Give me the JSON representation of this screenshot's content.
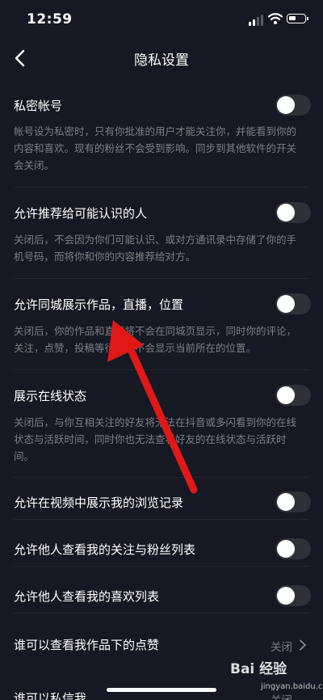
{
  "status_bar": {
    "time": "12:59"
  },
  "nav": {
    "title": "隐私设置"
  },
  "settings": [
    {
      "title": "私密帐号",
      "desc": "帐号设为私密时，只有你批准的用户才能关注你，并能看到你的内容和喜欢。现有的粉丝不会受到影响。同步到其他软件的开关会关闭。",
      "enabled": false
    },
    {
      "title": "允许推荐给可能认识的人",
      "desc": "关闭后，不会因为你们可能认识、或对方通讯录中存储了你的手机号码，而将你和你的内容推荐给对方。",
      "enabled": false
    },
    {
      "title": "允许同城展示作品，直播，位置",
      "desc": "关闭后，你的作品和直播将不会在同城页显示，同时你的评论，关注，点赞，投稿等行为也不会显示当前所在的位置。",
      "enabled": false
    },
    {
      "title": "展示在线状态",
      "desc": "关闭后，与你互相关注的好友将无法在抖音或多闪看到你的在线状态与活跃时间，同时你也无法查看好友的在线状态与活跃时间。",
      "enabled": false
    },
    {
      "title": "允许在视频中展示我的浏览记录",
      "enabled": false
    },
    {
      "title": "允许他人查看我的关注与粉丝列表",
      "enabled": false
    },
    {
      "title": "允许他人查看我的喜欢列表",
      "enabled": false
    },
    {
      "title": "谁可以查看我作品下的点赞",
      "value": "关闭"
    },
    {
      "title": "谁可以私信我",
      "value": "关闭"
    }
  ],
  "watermark": {
    "brand": "Bai 经验",
    "url": "jingyan.baidu.com"
  },
  "colors": {
    "background": "#161823",
    "annotation_arrow": "#e01818",
    "toggle_off": "#2f3038"
  },
  "icons": {
    "back": "chevron-left-icon",
    "more": "chevron-right-icon",
    "annotation": "red-arrow-icon"
  }
}
